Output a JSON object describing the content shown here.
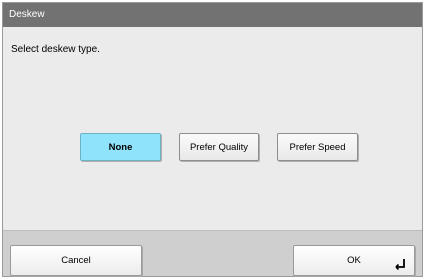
{
  "dialog": {
    "title": "Deskew",
    "prompt": "Select deskew type."
  },
  "options": [
    {
      "label": "None",
      "selected": true
    },
    {
      "label": "Prefer Quality",
      "selected": false
    },
    {
      "label": "Prefer Speed",
      "selected": false
    }
  ],
  "footer": {
    "cancel_label": "Cancel",
    "ok_label": "OK",
    "ok_icon": "enter-icon"
  },
  "colors": {
    "titlebar": "#727272",
    "selected_option": "#8fe3fb",
    "body": "#ebebeb",
    "footer": "#cfcfcf"
  }
}
